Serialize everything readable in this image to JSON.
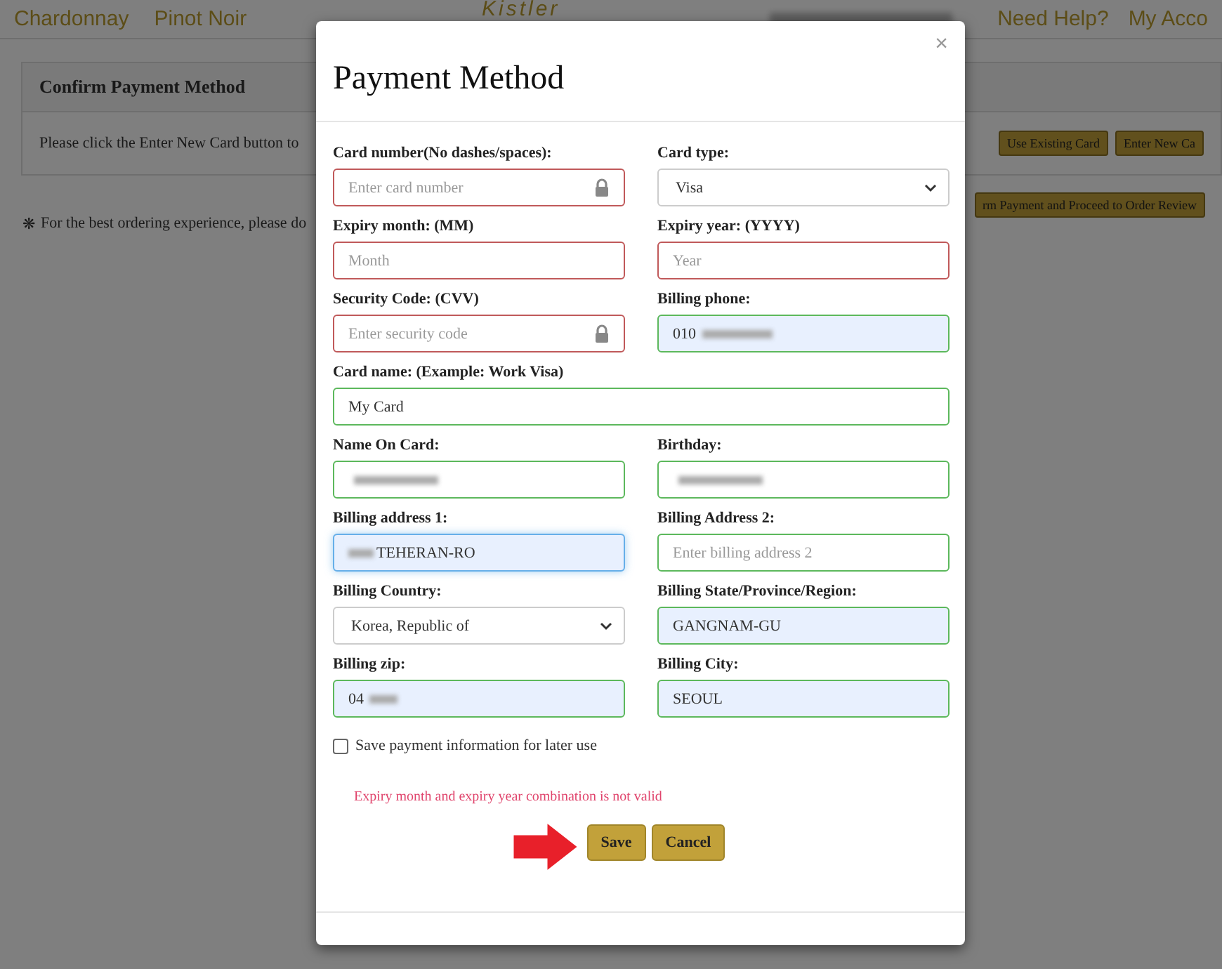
{
  "header": {
    "nav": [
      "Chardonnay",
      "Pinot Noir"
    ],
    "logo": "Kistler",
    "links": [
      "Need Help?",
      "My Acco"
    ]
  },
  "page": {
    "panel_title": "Confirm Payment Method",
    "instruction": "Please click the Enter New Card button to",
    "buttons": [
      "Use Existing Card",
      "Enter New Ca"
    ],
    "proceed_button": "rm Payment and Proceed to Order Review",
    "note_mark": "❋",
    "note": "For the best ordering experience, please do"
  },
  "modal": {
    "title": "Payment Method",
    "close": "×",
    "fields": [
      {
        "label": "Card number(No dashes/spaces):",
        "kind": "input",
        "placeholder": "Enter card number",
        "invalid": true,
        "valid": false,
        "lock": true,
        "autofilled": false,
        "focused": false,
        "blurred": false
      },
      {
        "label": "Card type:",
        "kind": "select",
        "value": "Visa"
      },
      {
        "label": "Expiry month: (MM)",
        "kind": "input",
        "placeholder": "Month",
        "invalid": true,
        "valid": false,
        "lock": false,
        "autofilled": false,
        "focused": false,
        "blurred": false
      },
      {
        "label": "Expiry year: (YYYY)",
        "kind": "input",
        "placeholder": "Year",
        "invalid": true,
        "valid": false,
        "lock": false,
        "autofilled": false,
        "focused": false,
        "blurred": false
      },
      {
        "label": "Security Code: (CVV)",
        "kind": "input",
        "placeholder": "Enter security code",
        "invalid": true,
        "valid": false,
        "lock": true,
        "autofilled": false,
        "focused": false,
        "blurred": false
      },
      {
        "label": "Billing phone:",
        "kind": "input",
        "value": "010",
        "blurred": true,
        "invalid": false,
        "valid": true,
        "lock": false,
        "autofilled": true,
        "focused": false
      },
      {
        "label": "Card name: (Example: Work Visa)",
        "kind": "wide-input",
        "value": "My Card",
        "invalid": false,
        "valid": true,
        "lock": false,
        "autofilled": false,
        "focused": false,
        "blurred": false
      },
      {
        "label": "Name On Card:",
        "kind": "input",
        "blurred": true,
        "invalid": false,
        "valid": true,
        "lock": false,
        "autofilled": false,
        "focused": false
      },
      {
        "label": "Birthday:",
        "kind": "input",
        "blurred": true,
        "invalid": false,
        "valid": true,
        "lock": false,
        "autofilled": false,
        "focused": false
      },
      {
        "label": "Billing address 1:",
        "kind": "input",
        "value": "TEHERAN-RO",
        "blurred": true,
        "invalid": false,
        "valid": false,
        "lock": false,
        "autofilled": true,
        "focused": true
      },
      {
        "label": "Billing Address 2:",
        "kind": "input",
        "placeholder": "Enter billing address 2",
        "invalid": false,
        "valid": true,
        "lock": false,
        "autofilled": false,
        "focused": false,
        "blurred": false
      },
      {
        "label": "Billing Country:",
        "kind": "select",
        "value": "Korea, Republic of"
      },
      {
        "label": "Billing State/Province/Region:",
        "kind": "input",
        "value": "GANGNAM-GU",
        "invalid": false,
        "valid": true,
        "lock": false,
        "autofilled": true,
        "focused": false,
        "blurred": false
      },
      {
        "label": "Billing zip:",
        "kind": "input",
        "value": "04",
        "blurred": true,
        "invalid": false,
        "valid": true,
        "lock": false,
        "autofilled": true,
        "focused": false
      },
      {
        "label": "Billing City:",
        "kind": "input",
        "value": "SEOUL",
        "invalid": false,
        "valid": true,
        "lock": false,
        "autofilled": true,
        "focused": false,
        "blurred": false
      }
    ],
    "save_checkbox": {
      "label": "Save payment information for later use",
      "checked": false
    },
    "error": "Expiry month and expiry year combination is not valid",
    "buttons": [
      "Save",
      "Cancel"
    ]
  }
}
